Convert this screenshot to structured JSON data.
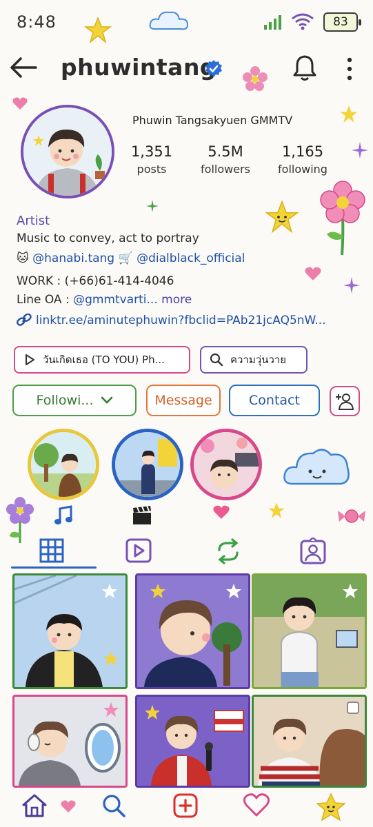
{
  "status_bar": {
    "time": "8:48",
    "battery": "83"
  },
  "header": {
    "username": "phuwintang"
  },
  "profile": {
    "display_name": "Phuwin Tangsakyuen GMMTV",
    "stats": [
      {
        "value": "1,351",
        "label": "posts"
      },
      {
        "value": "5.5M",
        "label": "followers"
      },
      {
        "value": "1,165",
        "label": "following"
      }
    ]
  },
  "bio": {
    "category": "Artist",
    "line1": "Music to convey, act to portray",
    "tag1": "@hanabi.tang",
    "tag2": "@dialblack_official",
    "work": "WORK : (+66)61-414-4046",
    "line_oa_prefix": "Line OA : ",
    "line_oa_handle": "@gmmtvarti...",
    "more": "more",
    "link": "linktr.ee/aminutephuwin?fbclid=PAb21jcAQ5nW..."
  },
  "chips": {
    "music": "วันเกิดเธอ (TO YOU) Ph...",
    "search": "ความวุ่นวาย"
  },
  "actions": {
    "following": "Followi...",
    "message": "Message",
    "contact": "Contact"
  },
  "icons": {
    "back": "arrow-left-icon",
    "verified": "verified-badge-icon",
    "bell": "bell-icon",
    "more": "more-vertical-icon",
    "music": "music-note-icon",
    "clapper": "clapperboard-icon",
    "grid": "grid-icon",
    "reels": "reels-icon",
    "reposts": "repost-icon",
    "tagged": "tagged-icon"
  },
  "colors": {
    "accent_blue": "#2a63c2",
    "following_green": "#357a31",
    "message_orange": "#d4632a",
    "contact_blue": "#2257a1"
  }
}
